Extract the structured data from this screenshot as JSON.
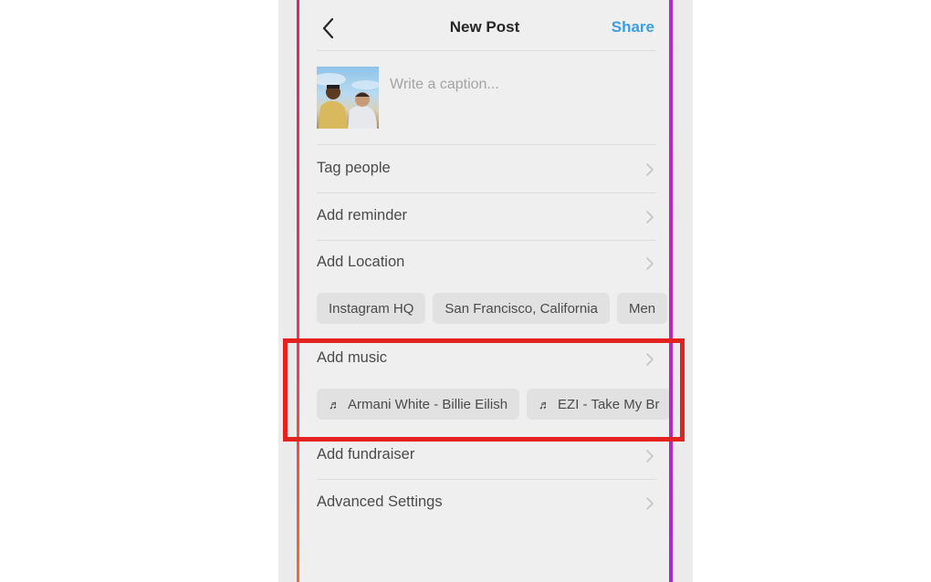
{
  "header": {
    "title": "New Post",
    "share_label": "Share",
    "back_icon": "chevron-left-icon"
  },
  "caption": {
    "placeholder": "Write a caption...",
    "value": ""
  },
  "rows": {
    "tag_people": "Tag people",
    "add_reminder": "Add reminder",
    "add_location": "Add Location",
    "add_music": "Add music",
    "add_fundraiser": "Add fundraiser",
    "advanced_settings": "Advanced Settings"
  },
  "location_suggestions": [
    "Instagram HQ",
    "San Francisco, California",
    "Men"
  ],
  "music_suggestions": [
    "Armani White - Billie Eilish",
    "EZI - Take My Br"
  ],
  "colors": {
    "accent": "#3b9ee2",
    "highlight_box": "#e3211f",
    "frame_left": "#e0386a",
    "frame_right": "#b12ccb"
  }
}
